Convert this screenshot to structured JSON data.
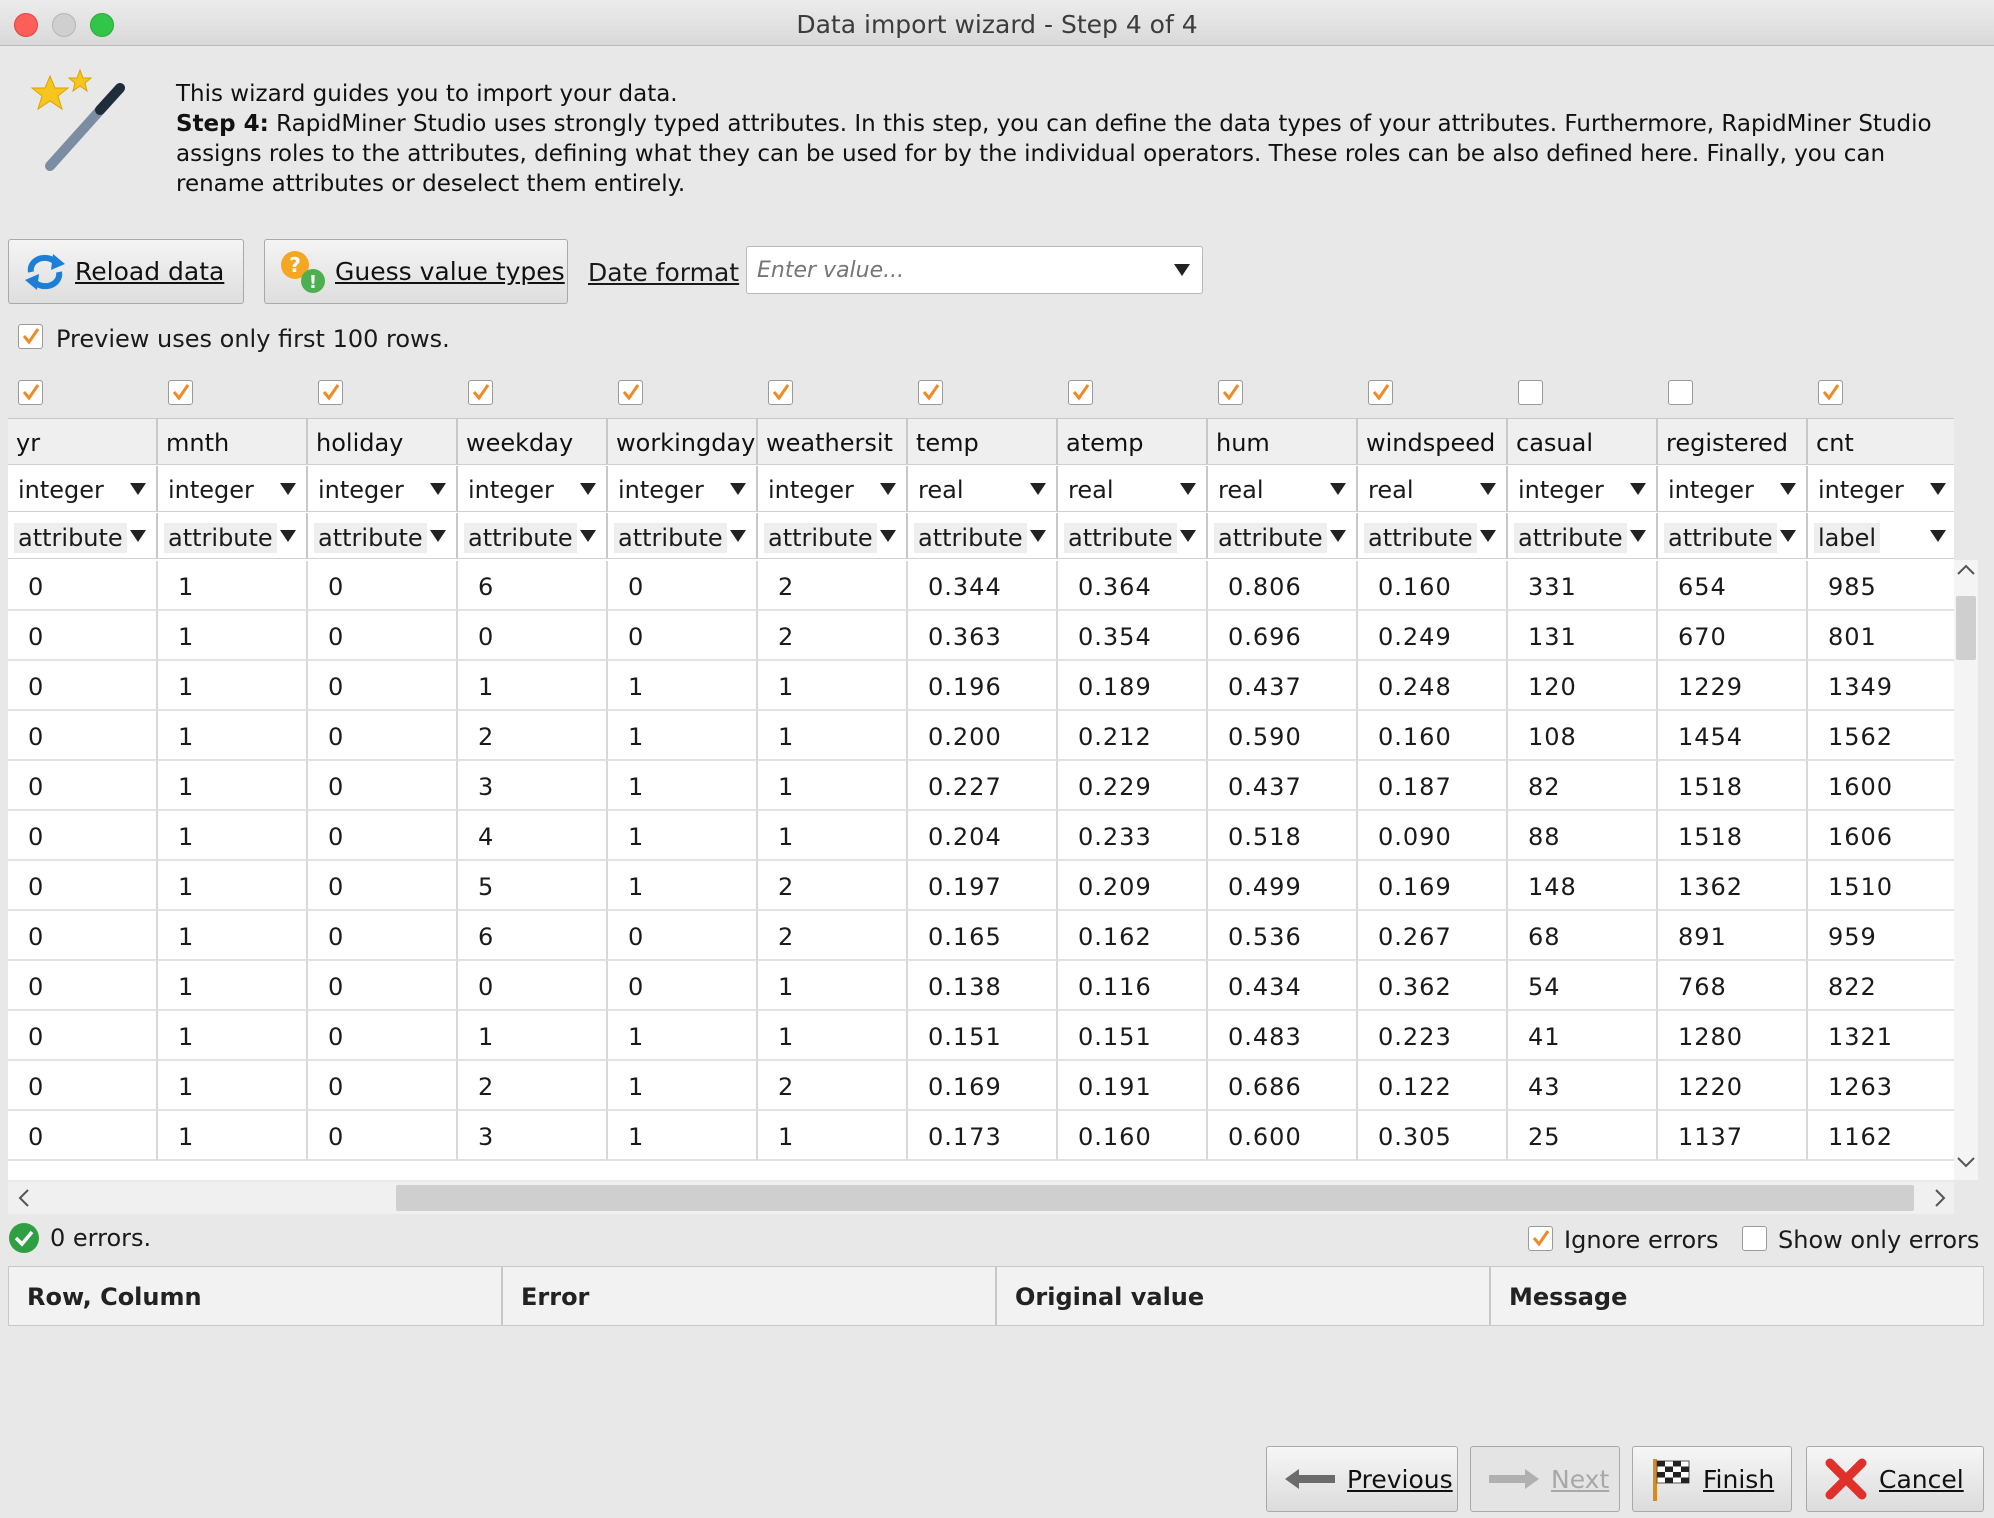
{
  "window": {
    "title": "Data import wizard - Step 4 of 4"
  },
  "intro": {
    "line1": "This wizard guides you to import your data.",
    "step_label": "Step 4:",
    "step_text": " RapidMiner Studio uses strongly typed attributes. In this step, you can define the data types of your attributes. Furthermore, RapidMiner Studio assigns roles to the attributes, defining what they can be used for by the individual operators. These roles can be also defined here. Finally, you can rename attributes or deselect them entirely."
  },
  "toolbar": {
    "reload_label": "Reload data",
    "guess_label": "Guess value types",
    "date_format_label": "Date format",
    "date_format_placeholder": "Enter value...",
    "date_format_value": ""
  },
  "preview": {
    "label": "Preview uses only first 100 rows.",
    "checked": true
  },
  "columns": [
    {
      "name": "yr",
      "type": "integer",
      "role": "attribute",
      "selected": true
    },
    {
      "name": "mnth",
      "type": "integer",
      "role": "attribute",
      "selected": true
    },
    {
      "name": "holiday",
      "type": "integer",
      "role": "attribute",
      "selected": true
    },
    {
      "name": "weekday",
      "type": "integer",
      "role": "attribute",
      "selected": true
    },
    {
      "name": "workingday",
      "type": "integer",
      "role": "attribute",
      "selected": true
    },
    {
      "name": "weathersit",
      "type": "integer",
      "role": "attribute",
      "selected": true
    },
    {
      "name": "temp",
      "type": "real",
      "role": "attribute",
      "selected": true
    },
    {
      "name": "atemp",
      "type": "real",
      "role": "attribute",
      "selected": true
    },
    {
      "name": "hum",
      "type": "real",
      "role": "attribute",
      "selected": true
    },
    {
      "name": "windspeed",
      "type": "real",
      "role": "attribute",
      "selected": true
    },
    {
      "name": "casual",
      "type": "integer",
      "role": "attribute",
      "selected": false
    },
    {
      "name": "registered",
      "type": "integer",
      "role": "attribute",
      "selected": false
    },
    {
      "name": "cnt",
      "type": "integer",
      "role": "label",
      "selected": true
    }
  ],
  "rows": [
    [
      "0",
      "1",
      "0",
      "6",
      "0",
      "2",
      "0.344",
      "0.364",
      "0.806",
      "0.160",
      "331",
      "654",
      "985"
    ],
    [
      "0",
      "1",
      "0",
      "0",
      "0",
      "2",
      "0.363",
      "0.354",
      "0.696",
      "0.249",
      "131",
      "670",
      "801"
    ],
    [
      "0",
      "1",
      "0",
      "1",
      "1",
      "1",
      "0.196",
      "0.189",
      "0.437",
      "0.248",
      "120",
      "1229",
      "1349"
    ],
    [
      "0",
      "1",
      "0",
      "2",
      "1",
      "1",
      "0.200",
      "0.212",
      "0.590",
      "0.160",
      "108",
      "1454",
      "1562"
    ],
    [
      "0",
      "1",
      "0",
      "3",
      "1",
      "1",
      "0.227",
      "0.229",
      "0.437",
      "0.187",
      "82",
      "1518",
      "1600"
    ],
    [
      "0",
      "1",
      "0",
      "4",
      "1",
      "1",
      "0.204",
      "0.233",
      "0.518",
      "0.090",
      "88",
      "1518",
      "1606"
    ],
    [
      "0",
      "1",
      "0",
      "5",
      "1",
      "2",
      "0.197",
      "0.209",
      "0.499",
      "0.169",
      "148",
      "1362",
      "1510"
    ],
    [
      "0",
      "1",
      "0",
      "6",
      "0",
      "2",
      "0.165",
      "0.162",
      "0.536",
      "0.267",
      "68",
      "891",
      "959"
    ],
    [
      "0",
      "1",
      "0",
      "0",
      "0",
      "1",
      "0.138",
      "0.116",
      "0.434",
      "0.362",
      "54",
      "768",
      "822"
    ],
    [
      "0",
      "1",
      "0",
      "1",
      "1",
      "1",
      "0.151",
      "0.151",
      "0.483",
      "0.223",
      "41",
      "1280",
      "1321"
    ],
    [
      "0",
      "1",
      "0",
      "2",
      "1",
      "2",
      "0.169",
      "0.191",
      "0.686",
      "0.122",
      "43",
      "1220",
      "1263"
    ],
    [
      "0",
      "1",
      "0",
      "3",
      "1",
      "1",
      "0.173",
      "0.160",
      "0.600",
      "0.305",
      "25",
      "1137",
      "1162"
    ]
  ],
  "errors": {
    "summary": "0 errors.",
    "ignore_label": "Ignore errors",
    "ignore_checked": true,
    "show_only_label": "Show only errors",
    "show_only_checked": false,
    "columns": [
      "Row, Column",
      "Error",
      "Original value",
      "Message"
    ]
  },
  "nav": {
    "previous": "Previous",
    "next": "Next",
    "finish": "Finish",
    "cancel": "Cancel"
  },
  "colors": {
    "accent": "#f08a24",
    "success": "#2ea043",
    "danger": "#e0302a"
  }
}
